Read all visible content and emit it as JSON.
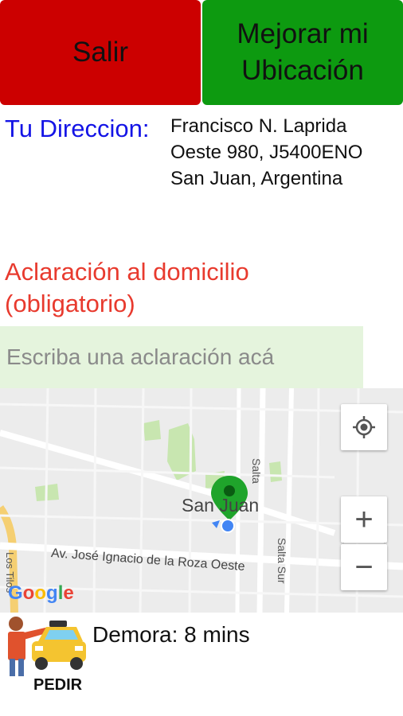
{
  "buttons": {
    "salir": "Salir",
    "mejorar": "Mejorar mi Ubicación"
  },
  "address": {
    "label": "Tu Direccion:",
    "value": "Francisco N. Laprida Oeste 980, J5400ENO San Juan, Argentina"
  },
  "aclaracion": {
    "title": "Aclaración al domicilio (obligatorio)",
    "placeholder": "Escriba una aclaración acá",
    "value": ""
  },
  "map": {
    "city_label": "San Juan",
    "street_av": "Av. José Ignacio de la Roza Oeste",
    "street_salta": "Salta",
    "street_salta_sur": "Salta Sur",
    "street_los_tilos": "Los Tilos",
    "zoom_in": "+",
    "zoom_out": "−",
    "brand": "Google",
    "colors": {
      "background": "#ececec",
      "park": "#c8e6b0",
      "pin": "#1fa42b",
      "user_dot": "#4285f4",
      "highway": "#f5cf72"
    }
  },
  "footer": {
    "pedir_label": "PEDIR",
    "demora": "Demora: 8 mins"
  },
  "colors": {
    "salir_bg": "#cc0000",
    "mejorar_bg": "#0d9a10",
    "address_label": "#1414e6",
    "aclaracion_title": "#e83a2e",
    "input_bg": "#e5f4dd"
  }
}
